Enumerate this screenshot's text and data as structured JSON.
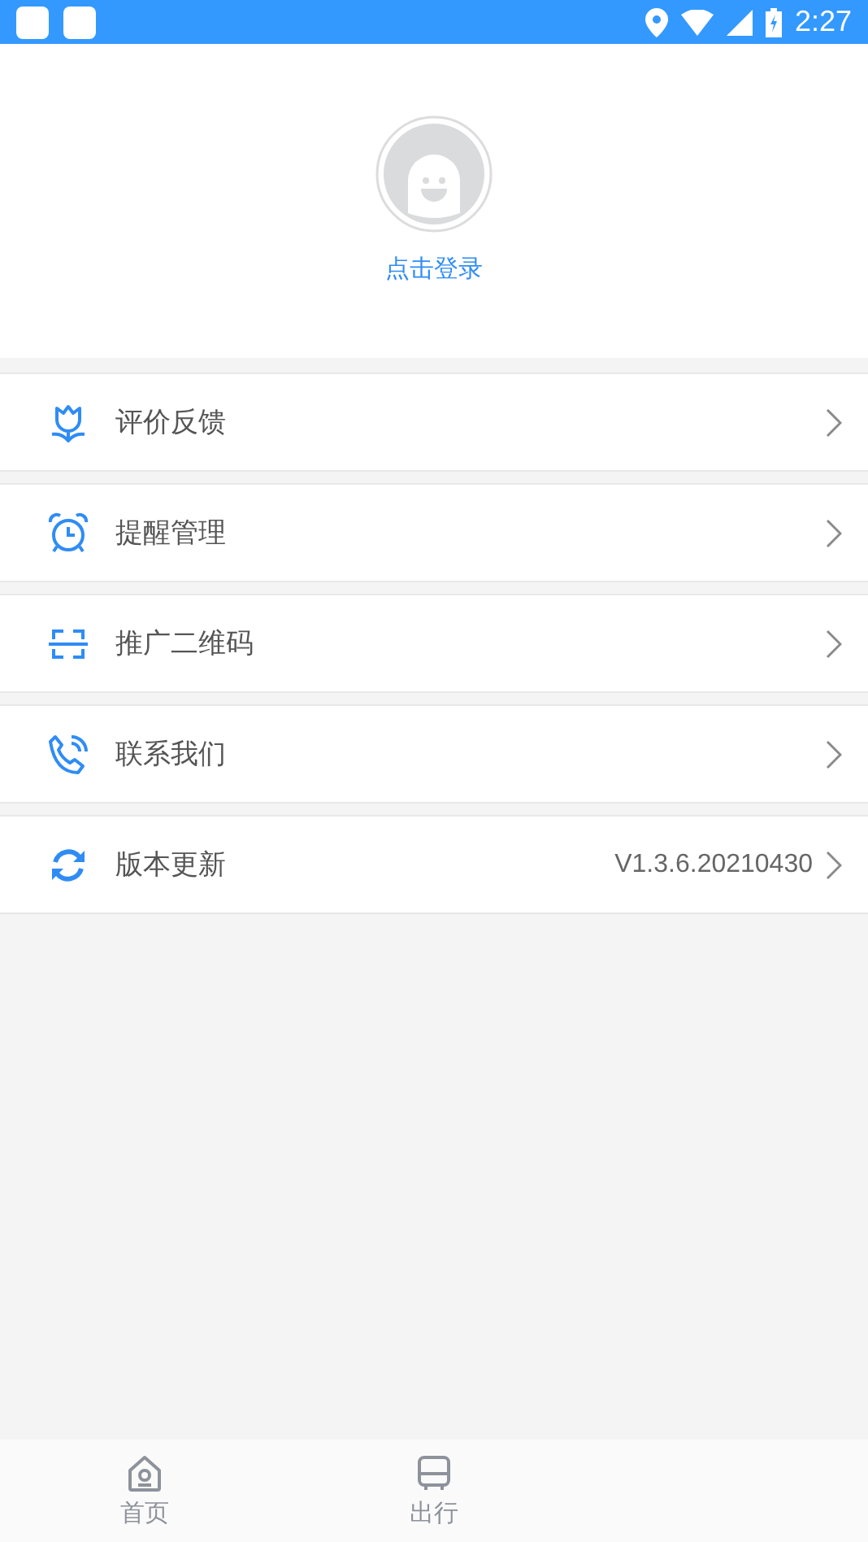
{
  "status_bar": {
    "time": "2:27"
  },
  "profile": {
    "login_label": "点击登录"
  },
  "menu": [
    {
      "kind": "feedback",
      "label": "评价反馈"
    },
    {
      "kind": "reminder",
      "label": "提醒管理"
    },
    {
      "kind": "qrcode",
      "label": "推广二维码"
    },
    {
      "kind": "contact",
      "label": "联系我们"
    },
    {
      "kind": "update",
      "label": "版本更新",
      "value": "V1.3.6.20210430"
    }
  ],
  "tab_bar": [
    {
      "kind": "home",
      "label": "首页",
      "selected": false
    },
    {
      "kind": "bus",
      "label": "出行",
      "selected": false
    }
  ]
}
